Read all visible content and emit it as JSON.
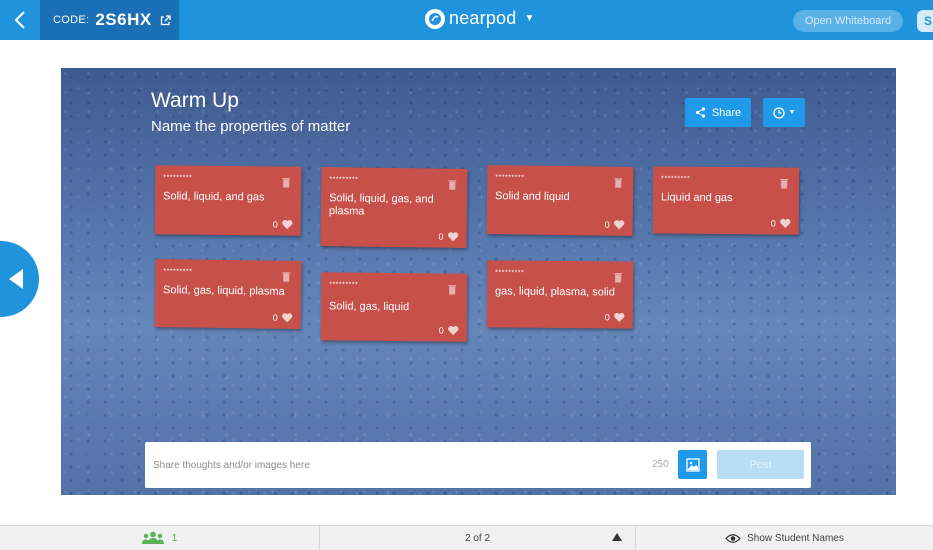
{
  "topbar": {
    "code_label": "CODE:",
    "code_value": "2S6HX",
    "brand_name": "nearpod",
    "whiteboard_label": "Open Whiteboard",
    "s_label": "S"
  },
  "board": {
    "title": "Warm Up",
    "subtitle": "Name the properties of matter",
    "share_label": "Share"
  },
  "cards": [
    {
      "stars": "*********",
      "text": "Solid, liquid, and gas",
      "likes": "0"
    },
    {
      "stars": "*********",
      "text": "Solid, liquid, gas, and plasma",
      "likes": "0"
    },
    {
      "stars": "*********",
      "text": "Solid and liquid",
      "likes": "0"
    },
    {
      "stars": "*********",
      "text": "Liquid and gas",
      "likes": "0"
    },
    {
      "stars": "*********",
      "text": "Solid, gas, liquid, plasma",
      "likes": "0"
    },
    {
      "stars": "*********",
      "text": "Solid, gas, liquid",
      "likes": "0"
    },
    {
      "stars": "*********",
      "text": "gas, liquid, plasma, solid",
      "likes": "0"
    }
  ],
  "postbar": {
    "placeholder": "Share thoughts and/or images here",
    "char_count": "250",
    "post_label": "Post"
  },
  "bottombar": {
    "student_count": "1",
    "pager": "2 of 2",
    "show_names_label": "Show Student Names"
  },
  "colors": {
    "primary": "#1f93db",
    "code_bg": "#1b6fb4",
    "card": "#c7514a",
    "students": "#57b356"
  }
}
